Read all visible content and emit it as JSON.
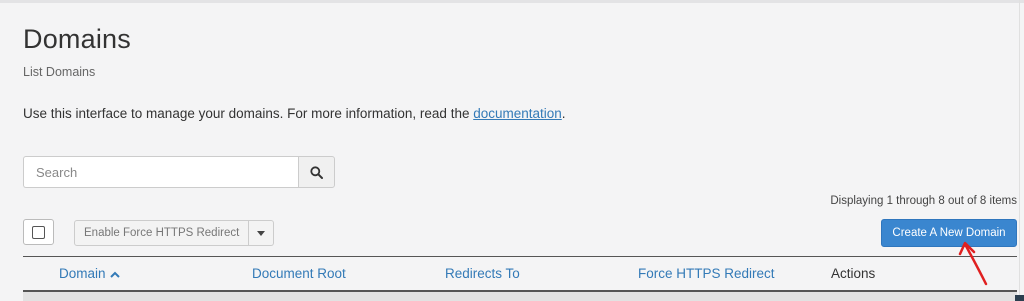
{
  "page": {
    "title": "Domains",
    "subtitle": "List Domains",
    "intro_text": "Use this interface to manage your domains. For more information, read the ",
    "intro_link": "documentation",
    "intro_end": "."
  },
  "search": {
    "placeholder": "Search",
    "value": "",
    "button_icon": "search-icon"
  },
  "pagination": {
    "display_text": "Displaying 1 through 8 out of 8 items"
  },
  "toolbar": {
    "bulk_action_label": "Enable Force HTTPS Redirect",
    "create_label": "Create A New Domain",
    "accent_color": "#3a86cf"
  },
  "table": {
    "columns": [
      {
        "label": "Domain",
        "sortable": true,
        "sort": "ascending"
      },
      {
        "label": "Document Root",
        "sortable": true
      },
      {
        "label": "Redirects To",
        "sortable": true
      },
      {
        "label": "Force HTTPS Redirect",
        "sortable": true
      },
      {
        "label": "Actions",
        "sortable": false
      }
    ]
  },
  "annotation": {
    "arrow_color": "#e02020",
    "arrow_target": "create-domain-button"
  }
}
